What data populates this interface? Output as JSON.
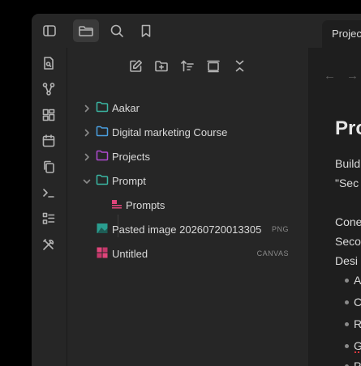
{
  "tabs": [
    {
      "label": "Project"
    }
  ],
  "explorer": {
    "items": [
      {
        "name": "Aakar",
        "kind": "folder",
        "expanded": false
      },
      {
        "name": "Digital marketing Course",
        "kind": "folder",
        "expanded": false
      },
      {
        "name": "Projects",
        "kind": "folder",
        "expanded": false
      },
      {
        "name": "Prompt",
        "kind": "folder",
        "expanded": true
      },
      {
        "name": "Prompts",
        "kind": "canvas-child"
      },
      {
        "name": "Pasted image 20260720013305",
        "kind": "image",
        "badge": "PNG"
      },
      {
        "name": "Untitled",
        "kind": "canvas",
        "badge": "CANVAS"
      }
    ]
  },
  "editor": {
    "title": "Pro",
    "lines": [
      "Build",
      "\"Sec",
      "",
      "Cone",
      "Seco",
      "Desi"
    ],
    "bullets": [
      "A",
      "C",
      "R",
      "G",
      "P"
    ]
  },
  "colors": {
    "folder_teal": "#3ab5a2",
    "folder_blue": "#4a9fe0",
    "folder_purple": "#b04bd1",
    "canvas_pink": "#e0457b",
    "image_teal": "#2a9d8f"
  }
}
